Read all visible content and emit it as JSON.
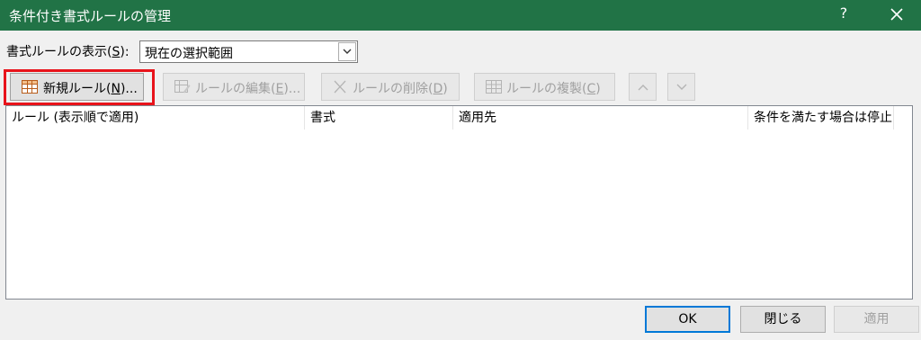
{
  "window": {
    "title": "条件付き書式ルールの管理",
    "help": "?",
    "title_bar_color": "#217346"
  },
  "show_rules": {
    "label_pre": "書式ルールの表示(",
    "label_key": "S",
    "label_post": "):",
    "selected": "現在の選択範囲"
  },
  "toolbar": {
    "new_rule": {
      "pre": "新規ルール(",
      "key": "N",
      "post": ")..."
    },
    "edit_rule": {
      "pre": "ルールの編集(",
      "key": "E",
      "post": ")..."
    },
    "delete_rule": {
      "pre": "ルールの削除(",
      "key": "D",
      "post": ")"
    },
    "duplicate_rule": {
      "pre": "ルールの複製(",
      "key": "C",
      "post": ")"
    }
  },
  "table": {
    "columns": [
      "ルール (表示順で適用)",
      "書式",
      "適用先",
      "条件を満たす場合は停止"
    ],
    "rows": []
  },
  "footer": {
    "ok": "OK",
    "close": "閉じる",
    "apply": "適用"
  },
  "highlight_color": "#e8131b"
}
